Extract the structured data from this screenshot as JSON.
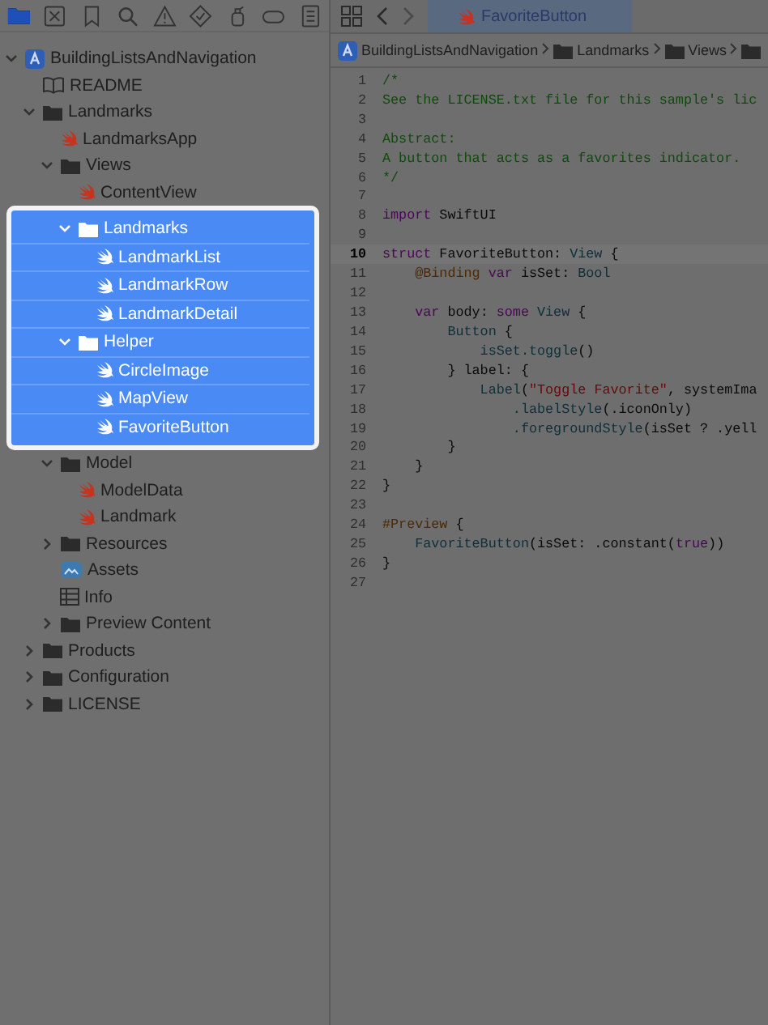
{
  "navigator_toolbar": [
    {
      "kind": "folder",
      "selected": true
    },
    {
      "kind": "xbox",
      "selected": false
    },
    {
      "kind": "bookmark",
      "selected": false
    },
    {
      "kind": "search",
      "selected": false
    },
    {
      "kind": "warning",
      "selected": false
    },
    {
      "kind": "diamond",
      "selected": false
    },
    {
      "kind": "spray",
      "selected": false
    },
    {
      "kind": "tag",
      "selected": false
    },
    {
      "kind": "doc",
      "selected": false
    }
  ],
  "tree": [
    {
      "label": "BuildingListsAndNavigation",
      "kind": "project",
      "expanded": true,
      "children": [
        {
          "label": "README",
          "kind": "readme"
        },
        {
          "label": "Landmarks",
          "kind": "folder",
          "expanded": true,
          "children": [
            {
              "label": "LandmarksApp",
              "kind": "swift"
            },
            {
              "label": "Views",
              "kind": "folder",
              "expanded": true,
              "children": [
                {
                  "label": "ContentView",
                  "kind": "swift"
                },
                {
                  "label": "Landmarks",
                  "kind": "folder",
                  "expanded": true,
                  "highlighted": true,
                  "children": [
                    {
                      "label": "LandmarkList",
                      "kind": "swift"
                    },
                    {
                      "label": "LandmarkRow",
                      "kind": "swift"
                    },
                    {
                      "label": "LandmarkDetail",
                      "kind": "swift"
                    }
                  ]
                },
                {
                  "label": "Helper",
                  "kind": "folder",
                  "expanded": true,
                  "highlighted": true,
                  "children": [
                    {
                      "label": "CircleImage",
                      "kind": "swift"
                    },
                    {
                      "label": "MapView",
                      "kind": "swift"
                    },
                    {
                      "label": "FavoriteButton",
                      "kind": "swift"
                    }
                  ]
                }
              ]
            },
            {
              "label": "Model",
              "kind": "folder",
              "expanded": true,
              "children": [
                {
                  "label": "ModelData",
                  "kind": "swift"
                },
                {
                  "label": "Landmark",
                  "kind": "swift"
                }
              ]
            },
            {
              "label": "Resources",
              "kind": "folder",
              "expanded": false
            },
            {
              "label": "Assets",
              "kind": "assets"
            },
            {
              "label": "Info",
              "kind": "info"
            },
            {
              "label": "Preview Content",
              "kind": "folder",
              "expanded": false
            }
          ]
        },
        {
          "label": "Products",
          "kind": "folder",
          "expanded": false
        },
        {
          "label": "Configuration",
          "kind": "folder",
          "expanded": false
        },
        {
          "label": "LICENSE",
          "kind": "folder",
          "expanded": false
        }
      ]
    }
  ],
  "editor": {
    "tab": {
      "label": "FavoriteButton",
      "kind": "swift",
      "selected": true
    },
    "breadcrumb": [
      {
        "label": "BuildingListsAndNavigation",
        "kind": "project"
      },
      {
        "label": "Landmarks",
        "kind": "folder"
      },
      {
        "label": "Views",
        "kind": "folder"
      },
      {
        "kind": "folder"
      }
    ],
    "lines": [
      {
        "number": "1",
        "current": false,
        "spans": [
          {
            "kind": "comment",
            "text": "/*"
          }
        ]
      },
      {
        "number": "2",
        "current": false,
        "spans": [
          {
            "kind": "comment",
            "text": "See the LICENSE.txt file for this sample's lic"
          }
        ]
      },
      {
        "number": "3",
        "current": false
      },
      {
        "number": "4",
        "current": false,
        "spans": [
          {
            "kind": "comment",
            "text": "Abstract:"
          }
        ]
      },
      {
        "number": "5",
        "current": false,
        "spans": [
          {
            "kind": "comment",
            "text": "A button that acts as a favorites indicator."
          }
        ]
      },
      {
        "number": "6",
        "current": false,
        "spans": [
          {
            "kind": "comment",
            "text": "*/"
          }
        ]
      },
      {
        "number": "7",
        "current": false
      },
      {
        "number": "8",
        "current": false,
        "spans": [
          {
            "kind": "keyword",
            "text": "import"
          },
          {
            "kind": "plain",
            "text": " SwiftUI"
          }
        ]
      },
      {
        "number": "9",
        "current": false
      },
      {
        "number": "10",
        "current": true,
        "spans": [
          {
            "kind": "keyword",
            "text": "struct"
          },
          {
            "kind": "plain",
            "text": " FavoriteButton:"
          },
          {
            "kind": "type",
            "text": " View"
          },
          {
            "kind": "plain",
            "text": " {"
          }
        ]
      },
      {
        "number": "11",
        "current": false,
        "spans": [
          {
            "kind": "attr",
            "text": "    @Binding"
          },
          {
            "kind": "keyword",
            "text": " var"
          },
          {
            "kind": "plain",
            "text": " isSet:"
          },
          {
            "kind": "type",
            "text": " Bool"
          }
        ]
      },
      {
        "number": "12",
        "current": false
      },
      {
        "number": "13",
        "current": false,
        "spans": [
          {
            "kind": "keyword",
            "text": "    var"
          },
          {
            "kind": "plain",
            "text": " body:"
          },
          {
            "kind": "keyword",
            "text": " some"
          },
          {
            "kind": "type",
            "text": " View"
          },
          {
            "kind": "plain",
            "text": " {"
          }
        ]
      },
      {
        "number": "14",
        "current": false,
        "spans": [
          {
            "kind": "type",
            "text": "        Button"
          },
          {
            "kind": "plain",
            "text": " {"
          }
        ]
      },
      {
        "number": "15",
        "current": false,
        "spans": [
          {
            "kind": "func",
            "text": "            isSet.toggle"
          },
          {
            "kind": "plain",
            "text": "()"
          }
        ]
      },
      {
        "number": "16",
        "current": false,
        "spans": [
          {
            "kind": "plain",
            "text": "        } label: {"
          }
        ]
      },
      {
        "number": "17",
        "current": false,
        "spans": [
          {
            "kind": "type",
            "text": "            Label"
          },
          {
            "kind": "plain",
            "text": "("
          },
          {
            "kind": "string",
            "text": "\"Toggle Favorite\""
          },
          {
            "kind": "plain",
            "text": ", systemIma"
          }
        ]
      },
      {
        "number": "18",
        "current": false,
        "spans": [
          {
            "kind": "func",
            "text": "                .labelStyle"
          },
          {
            "kind": "plain",
            "text": "(.iconOnly)"
          }
        ]
      },
      {
        "number": "19",
        "current": false,
        "spans": [
          {
            "kind": "func",
            "text": "                .foregroundStyle"
          },
          {
            "kind": "plain",
            "text": "(isSet ? .yell"
          }
        ]
      },
      {
        "number": "20",
        "current": false,
        "spans": [
          {
            "kind": "plain",
            "text": "        }"
          }
        ]
      },
      {
        "number": "21",
        "current": false,
        "spans": [
          {
            "kind": "plain",
            "text": "    }"
          }
        ]
      },
      {
        "number": "22",
        "current": false,
        "spans": [
          {
            "kind": "plain",
            "text": "}"
          }
        ]
      },
      {
        "number": "23",
        "current": false
      },
      {
        "number": "24",
        "current": false,
        "spans": [
          {
            "kind": "attr",
            "text": "#Preview"
          },
          {
            "kind": "plain",
            "text": " {"
          }
        ]
      },
      {
        "number": "25",
        "current": false,
        "spans": [
          {
            "kind": "type",
            "text": "    FavoriteButton"
          },
          {
            "kind": "plain",
            "text": "(isSet: .constant("
          },
          {
            "kind": "keyword",
            "text": "true"
          },
          {
            "kind": "plain",
            "text": "))"
          }
        ]
      },
      {
        "number": "26",
        "current": false,
        "spans": [
          {
            "kind": "plain",
            "text": "}"
          }
        ]
      },
      {
        "number": "27",
        "current": false
      }
    ]
  }
}
